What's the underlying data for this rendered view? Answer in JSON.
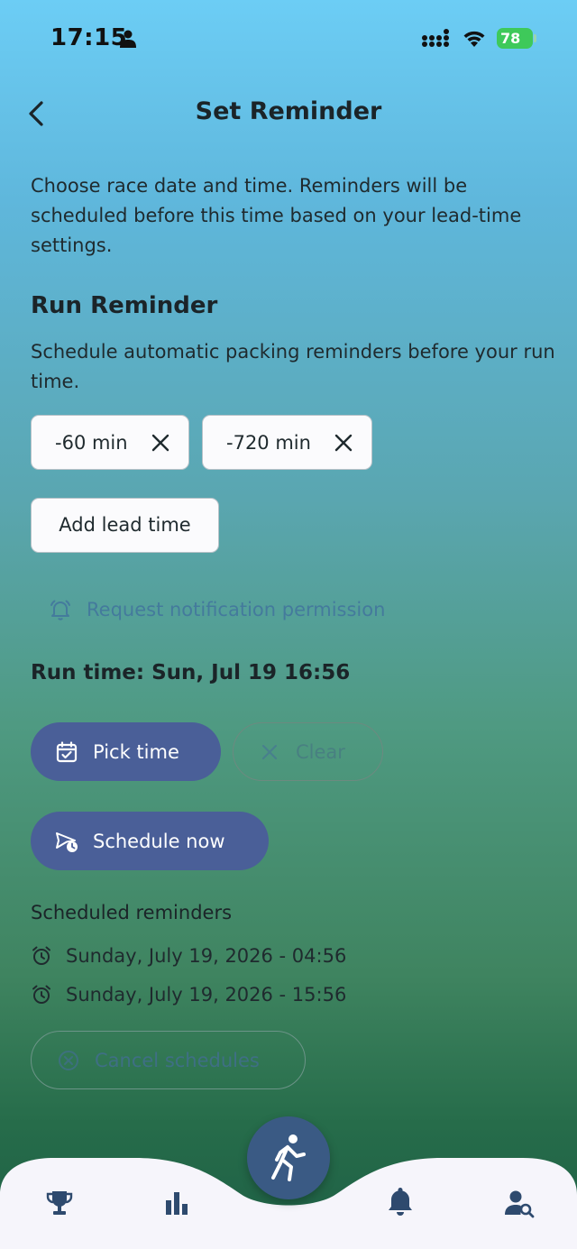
{
  "status_bar": {
    "time": "17:15",
    "battery": "78"
  },
  "header": {
    "title": "Set Reminder"
  },
  "intro": "Choose race date and time. Reminders will be scheduled before this time based on your lead-time settings.",
  "section": {
    "title": "Run Reminder",
    "description": "Schedule automatic packing reminders before your run time."
  },
  "lead_times": [
    {
      "label": "-60 min"
    },
    {
      "label": "-720 min"
    }
  ],
  "add_lead_time_label": "Add lead time",
  "permission_label": "Request notification permission",
  "run_time": "Run time: Sun, Jul 19 16:56",
  "buttons": {
    "pick_time": "Pick time",
    "clear": "Clear",
    "schedule_now": "Schedule now",
    "cancel_schedules": "Cancel schedules"
  },
  "scheduled": {
    "title": "Scheduled reminders",
    "items": [
      "Sunday, July 19, 2026 - 04:56",
      "Sunday, July 19, 2026 - 15:56"
    ]
  },
  "nav": {
    "items": [
      "trophy-icon",
      "bar-chart-icon",
      "runner-icon",
      "bell-icon",
      "profile-search-icon"
    ],
    "active": "bell-icon"
  },
  "colors": {
    "primary": "#4a5f98",
    "fab": "#3a5a84",
    "nav_icon": "#2e4a6e",
    "battery": "#3ec95a"
  }
}
